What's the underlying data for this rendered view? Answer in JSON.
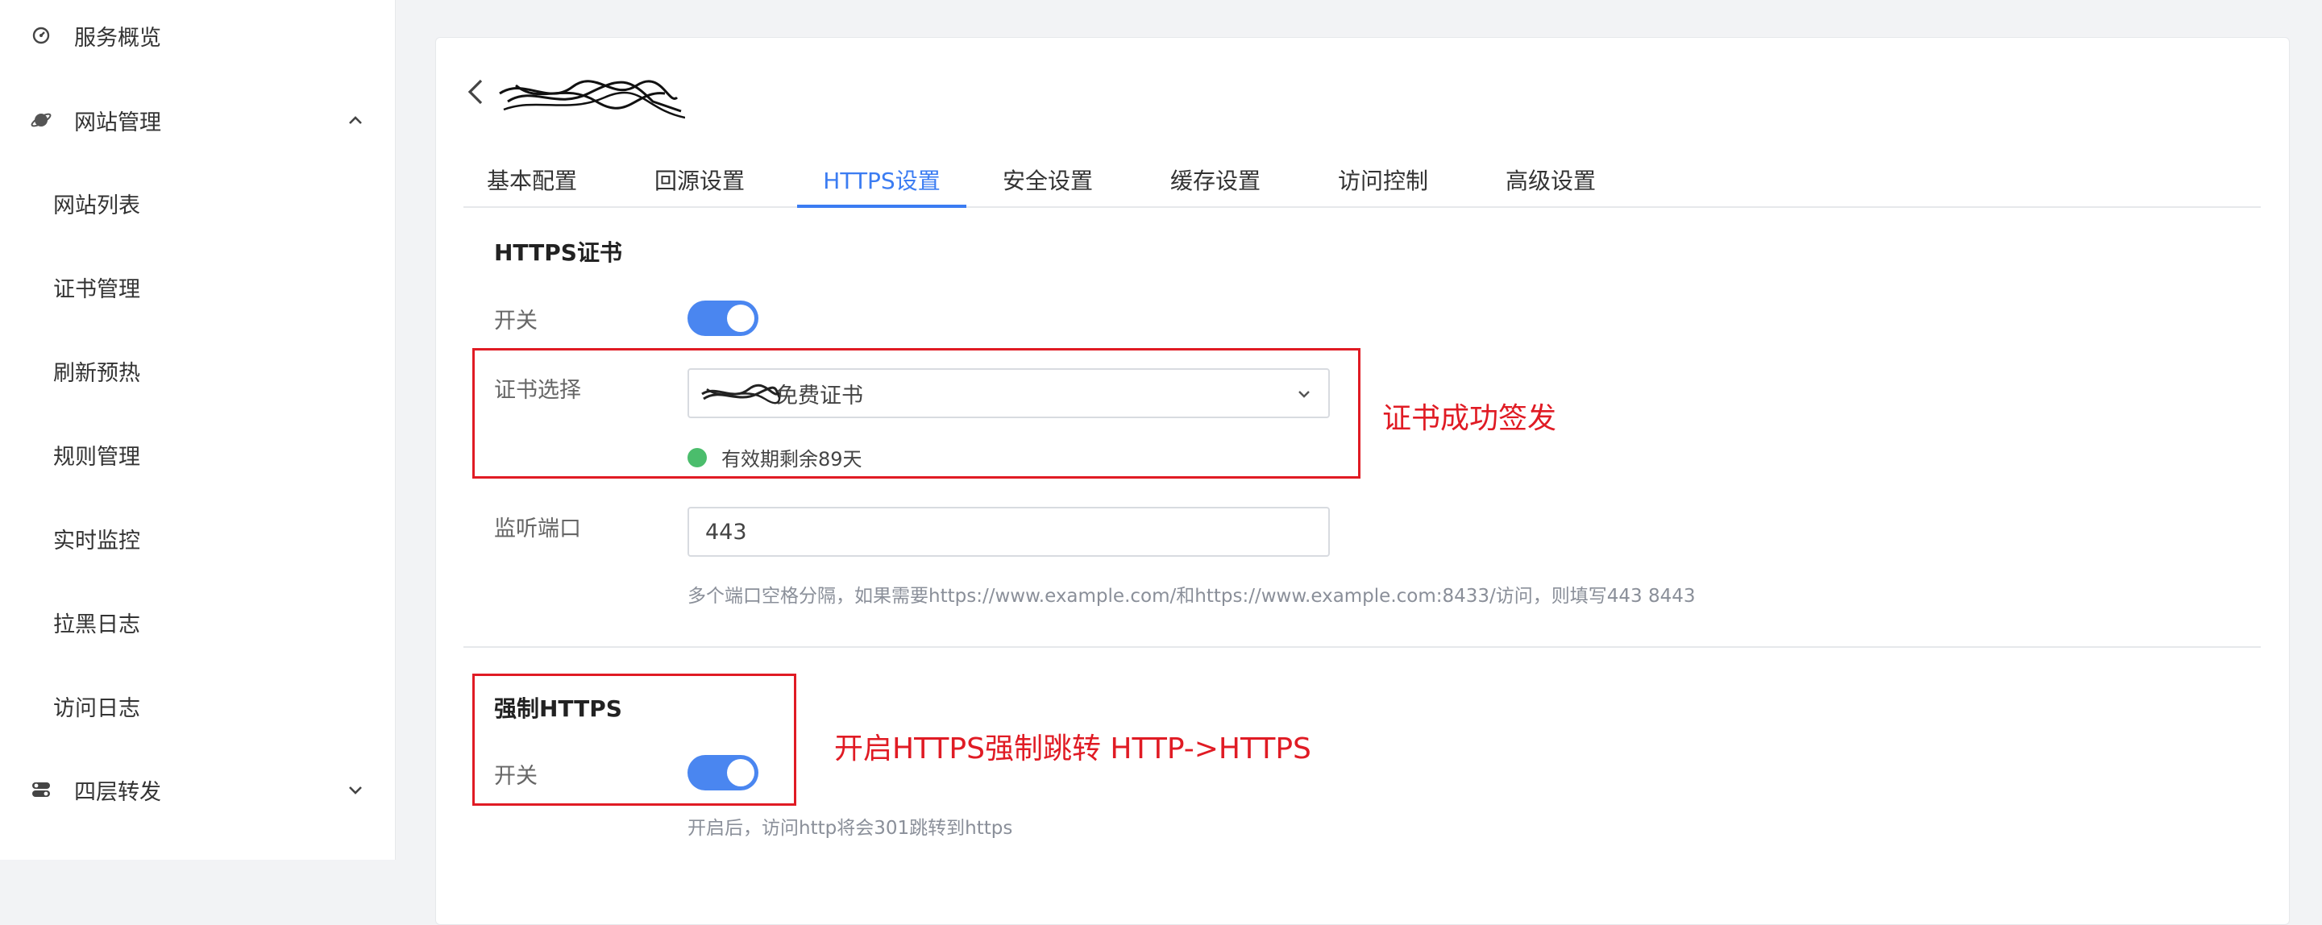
{
  "sidebar": {
    "items": [
      {
        "label": "服务概览",
        "icon": "dashboard-icon"
      },
      {
        "label": "网站管理",
        "icon": "globe-icon",
        "expanded": true,
        "chevron": "chevron-up-icon"
      },
      {
        "label": "网站列表"
      },
      {
        "label": "证书管理"
      },
      {
        "label": "刷新预热"
      },
      {
        "label": "规则管理"
      },
      {
        "label": "实时监控"
      },
      {
        "label": "拉黑日志"
      },
      {
        "label": "访问日志"
      },
      {
        "label": "四层转发",
        "icon": "toggle-icon",
        "expanded": false,
        "chevron": "chevron-down-icon"
      }
    ]
  },
  "header": {
    "back_icon": "arrow-left-icon"
  },
  "tabs": [
    {
      "label": "基本配置"
    },
    {
      "label": "回源设置"
    },
    {
      "label": "HTTPS设置",
      "active": true
    },
    {
      "label": "安全设置"
    },
    {
      "label": "缓存设置"
    },
    {
      "label": "访问控制"
    },
    {
      "label": "高级设置"
    }
  ],
  "https_cert": {
    "title": "HTTPS证书",
    "switch_label": "开关",
    "switch_on": true,
    "cert_label": "证书选择",
    "cert_value": "免费证书",
    "validity": "有效期剩余89天",
    "port_label": "监听端口",
    "port_value": "443",
    "port_hint": "多个端口空格分隔，如果需要https://www.example.com/和https://www.example.com:8433/访问，则填写443 8443"
  },
  "force_https": {
    "title": "强制HTTPS",
    "switch_label": "开关",
    "switch_on": true,
    "hint": "开启后，访问http将会301跳转到https"
  },
  "annotations": {
    "cert_note": "证书成功签发",
    "force_note": "开启HTTPS强制跳转  HTTP->HTTPS"
  },
  "colors": {
    "accent": "#3b7cf2",
    "toggle_on": "#4a86f0",
    "success": "#4bbd6c",
    "annotation_red": "#e01b24"
  }
}
